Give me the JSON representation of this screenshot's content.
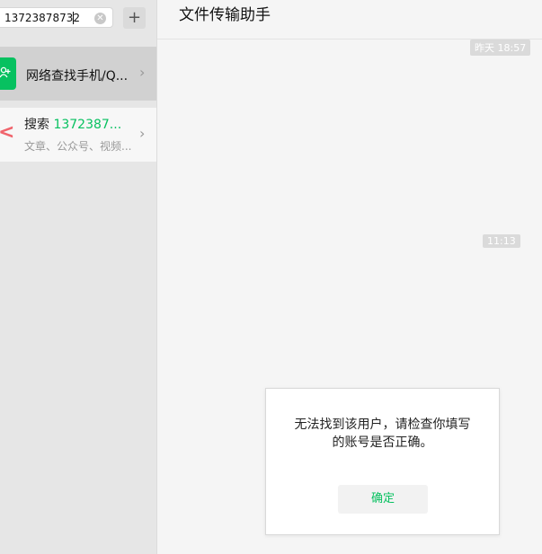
{
  "search": {
    "value": "13723878732"
  },
  "add_button": {
    "label": "+"
  },
  "results": [
    {
      "label": "网络查找手机/Q...",
      "chevron": "›"
    },
    {
      "prefix": "搜索",
      "query": "1372387...",
      "subtitle": "文章、公众号、视频...",
      "chevron": "›"
    }
  ],
  "chat": {
    "title": "文件传输助手",
    "timestamps": [
      "昨天 18:57",
      "11:13"
    ]
  },
  "dialog": {
    "message_line1": "无法找到该用户，请检查你填写",
    "message_line2": "的账号是否正确。",
    "ok_label": "确定"
  },
  "colors": {
    "accent": "#07c160",
    "search_icon": "#f0646c"
  }
}
